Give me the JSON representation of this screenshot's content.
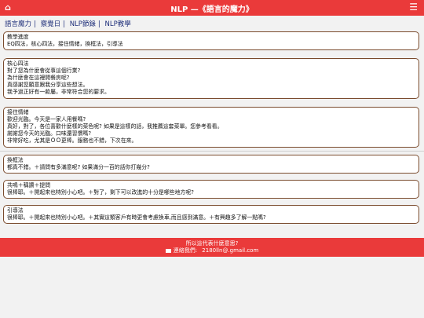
{
  "header": {
    "title": "NLP —《語言的魔力》",
    "home_icon": "⌂",
    "menu_icon": "☰"
  },
  "nav": {
    "items": [
      "語言魔力",
      "察覺日",
      "NLP節錄",
      "NLP教學"
    ],
    "separator": "|"
  },
  "sections": [
    {
      "title": "教學進度",
      "lines": [
        "EQ四法，核心四法，接住情緒，換框法，引導法"
      ]
    },
    {
      "title": "核心四法",
      "lines": [
        "對了您為什麼會從事這個行業?",
        "為什麼會在這裡開餐房呢?",
        "真感謝您願意跟我分享這些想法。",
        "我予過正好有一款屬，非常符合您的要求。"
      ]
    },
    {
      "title": "接住情緒",
      "lines": [
        "歡迎光臨。今天是一家人用餐嗎?",
        "真好，對了，各位喜歡什麼樣的菜色呢?  如果是這樣的話，我推薦這套菜單。您參考看看。",
        "謝謝您今天的光臨。口味還習慣嗎?",
        "非常好吃，尤其是ＯＯ更棒。服務也不錯，下次在來。"
      ]
    },
    {
      "title": "換框法",
      "lines": [
        "都真不錯。＋請問有多滿意呢? 如果滿分一百的話你打幾分?"
      ]
    },
    {
      "title": "共鳴＋稱讚＋提問",
      "lines": [
        "很棒耶。＋開起來也特別小心吧。＋對了，剩下可以改進的十分是哪些地方呢?"
      ]
    },
    {
      "title": "引導法",
      "lines": [
        "很棒耶。＋開起來也特別小心吧。＋其實這類客戶有時更會考慮換車,而且感到滿意。＋有興趣多了解一點嗎?"
      ]
    }
  ],
  "footer": {
    "line1": "所以這代表什麼意思?",
    "contact_label": "連絡我們:",
    "email": "2180lln@.gmail.com"
  }
}
